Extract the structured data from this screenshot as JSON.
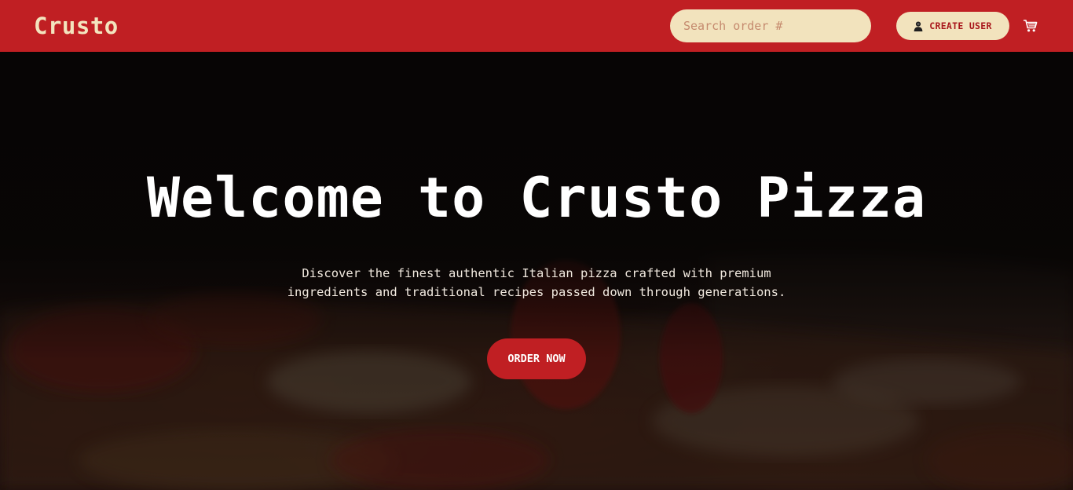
{
  "colors": {
    "brand_red": "#c01f23",
    "cream": "#f2e3bd",
    "hero_text": "#ffffff"
  },
  "header": {
    "logo": "Crusto",
    "search": {
      "placeholder": "Search order #",
      "value": ""
    },
    "create_user": {
      "label": "CREATE USER",
      "icon": "user-icon"
    },
    "cart": {
      "icon": "cart-icon"
    }
  },
  "hero": {
    "title": "Welcome to Crusto Pizza",
    "subtitle_line1": "Discover the finest authentic Italian pizza crafted with premium",
    "subtitle_line2": "ingredients and traditional recipes passed down through generations.",
    "cta_label": "ORDER NOW",
    "background": "pizza-photo"
  }
}
